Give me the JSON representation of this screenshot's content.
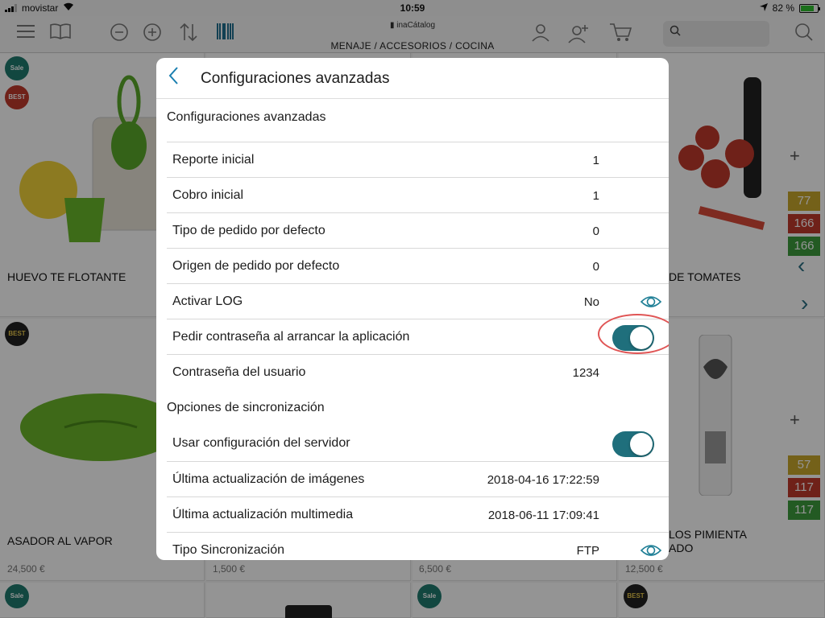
{
  "status_bar": {
    "carrier": "movistar",
    "time": "10:59",
    "battery_percent": "82 %",
    "battery_level": 0.82
  },
  "toolbar": {
    "brand": "inaCátalog",
    "breadcrumb": "MENAJE / ACCESORIOS / COCINA",
    "icons": [
      "menu-icon",
      "book-icon",
      "zoom-out-icon",
      "zoom-in-icon",
      "sort-icon",
      "barcode-icon",
      "user-icon",
      "add-user-icon",
      "cart-icon",
      "search-icon"
    ]
  },
  "background_products": {
    "row1": [
      {
        "name": "HUEVO TE FLOTANTE"
      },
      {
        "name": "R DE TOMATES",
        "stock": [
          "77",
          "166",
          "166"
        ]
      }
    ],
    "row2": [
      {
        "name": "ASADOR AL VAPOR",
        "price": "24,500 €"
      },
      {
        "price": "1,500 €"
      },
      {
        "price": "6,500 €"
      },
      {
        "name_lines": [
          "LOS PIMIENTA",
          "ADO"
        ],
        "price": "12,500 €",
        "stock": [
          "57",
          "117",
          "117"
        ]
      }
    ]
  },
  "modal": {
    "title": "Configuraciones avanzadas",
    "section1": {
      "title": "Configuraciones avanzadas",
      "rows": [
        {
          "label": "Reporte inicial",
          "value": "1"
        },
        {
          "label": "Cobro inicial",
          "value": "1"
        },
        {
          "label": "Tipo de pedido por defecto",
          "value": "0"
        },
        {
          "label": "Origen de pedido por defecto",
          "value": "0"
        },
        {
          "label": "Activar LOG",
          "value": "No"
        },
        {
          "label": "Pedir contraseña al arrancar la aplicación",
          "toggle_on": true
        },
        {
          "label": "Contraseña del usuario",
          "value": "1234"
        }
      ]
    },
    "section2": {
      "title": "Opciones de sincronización",
      "rows": [
        {
          "label": "Usar configuración del servidor",
          "toggle_on": true
        },
        {
          "label": "Última actualización de imágenes",
          "value": "2018-04-16 17:22:59"
        },
        {
          "label": "Última actualización multimedia",
          "value": "2018-06-11 17:09:41"
        },
        {
          "label": "Tipo Sincronización",
          "value": "FTP"
        }
      ]
    }
  },
  "colors": {
    "toggle_on": "#1f6f7c",
    "highlight_ring": "#e05555",
    "accent": "#1a7fb0",
    "stock_yellow": "#c9a82c",
    "stock_red": "#c0392b",
    "stock_green": "#3d9b3d"
  }
}
